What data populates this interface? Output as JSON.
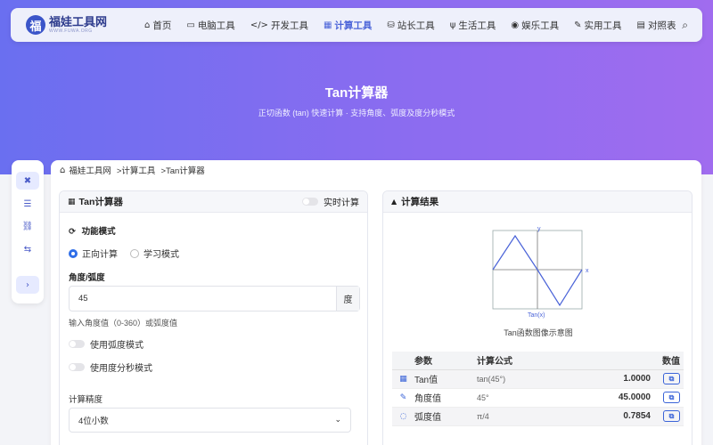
{
  "brand": {
    "name": "福娃工具网",
    "sub": "WWW.FUWA.ORG",
    "logo_char": "福"
  },
  "nav": [
    {
      "label": "首页",
      "icon": "⌂",
      "name": "home"
    },
    {
      "label": "电脑工具",
      "icon": "▭",
      "name": "pc-tools"
    },
    {
      "label": "开发工具",
      "icon": "</>",
      "name": "dev-tools"
    },
    {
      "label": "计算工具",
      "icon": "▦",
      "name": "calc-tools"
    },
    {
      "label": "站长工具",
      "icon": "⛁",
      "name": "webmaster-tools"
    },
    {
      "label": "生活工具",
      "icon": "ψ",
      "name": "life-tools"
    },
    {
      "label": "娱乐工具",
      "icon": "◉",
      "name": "fun-tools"
    },
    {
      "label": "实用工具",
      "icon": "✎",
      "name": "utility-tools"
    },
    {
      "label": "对照表",
      "icon": "▤",
      "name": "tables"
    }
  ],
  "search_icon": "⌕",
  "hero": {
    "title": "Tan计算器",
    "subtitle": "正切函数 (tan) 快速计算 · 支持角度、弧度及度分秒模式"
  },
  "sidebar": [
    "✖",
    "☰",
    "⛓",
    "⇆",
    "›"
  ],
  "breadcrumb": {
    "home": "福娃工具网",
    "cat": ">计算工具",
    "page": ">Tan计算器"
  },
  "calc": {
    "title": "Tan计算器",
    "realtime_label": "实时计算",
    "mode_label": "功能模式",
    "mode_forward": "正向计算",
    "mode_learn": "学习模式",
    "angle_label": "角度/弧度",
    "angle_value": "45",
    "unit": "度",
    "hint": "输入角度值（0-360）或弧度值",
    "radian_mode": "使用弧度模式",
    "dms_mode": "使用度分秒模式",
    "precision_label": "计算精度",
    "precision_value": "4位小数"
  },
  "result": {
    "title": "计算结果",
    "graph_caption": "Tan函数图像示意图",
    "graph_y": "y",
    "graph_x": "x",
    "graph_label": "Tan(x)",
    "headers": [
      "参数",
      "计算公式",
      "数值"
    ],
    "rows": [
      {
        "icon": "▦",
        "param": "Tan值",
        "formula": "tan(45°)",
        "value": "1.0000"
      },
      {
        "icon": "✎",
        "param": "角度值",
        "formula": "45°",
        "value": "45.0000"
      },
      {
        "icon": "◌",
        "param": "弧度值",
        "formula": "π/4",
        "value": "0.7854"
      }
    ],
    "copy_icon": "⧉"
  },
  "colors": {
    "accent": "#4a63d8",
    "hero_start": "#6a6ff0",
    "hero_end": "#a06cef"
  }
}
